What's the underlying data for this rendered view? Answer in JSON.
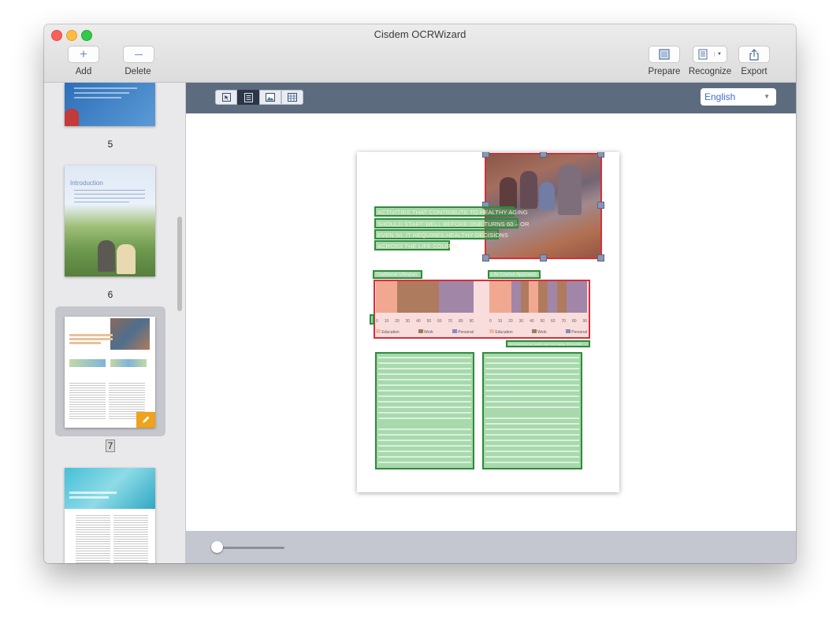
{
  "window": {
    "title": "Cisdem OCRWizard"
  },
  "toolbar": {
    "add_label": "Add",
    "delete_label": "Delete",
    "prepare_label": "Prepare",
    "recognize_label": "Recognize",
    "export_label": "Export"
  },
  "sidebar": {
    "pages": [
      {
        "number": "5"
      },
      {
        "number": "6",
        "thumb_title": "Introduction"
      },
      {
        "number": "7",
        "selected": true
      },
      {
        "number": ""
      }
    ]
  },
  "canvas_toolbar": {
    "language": "English",
    "tools": [
      "select-tool",
      "text-region-tool",
      "image-region-tool",
      "table-region-tool"
    ],
    "active_tool": "text-region-tool"
  },
  "document": {
    "heading_lines": [
      "ACTIVITIES THAT CONTRIBUTE TO HEALTHY AGING",
      "SHOULD START WELL BEFORE ONE TURNS 60 – OR",
      "EVEN 50. IT REQUIRES HEALTHY DECISIONS",
      "ACROSS THE LIFE COURSE."
    ],
    "left_chart_label": "Traditional Lifespan",
    "right_chart_label": "Life Course Approach",
    "caption": "Life course in the health care and Aging, WHO 2002",
    "legend": [
      "Education",
      "Work",
      "Personal"
    ],
    "ticks": [
      "0",
      "10",
      "20",
      "30",
      "40",
      "50",
      "60",
      "70",
      "80",
      "90"
    ]
  },
  "colors": {
    "region_text": "#2e8b3a",
    "region_image": "#d6303a",
    "toolbar_bg": "#5d6b7e",
    "accent": "#3a6fd0",
    "edit_badge": "#f0a21c"
  },
  "zoom": {
    "level": 0.05
  }
}
